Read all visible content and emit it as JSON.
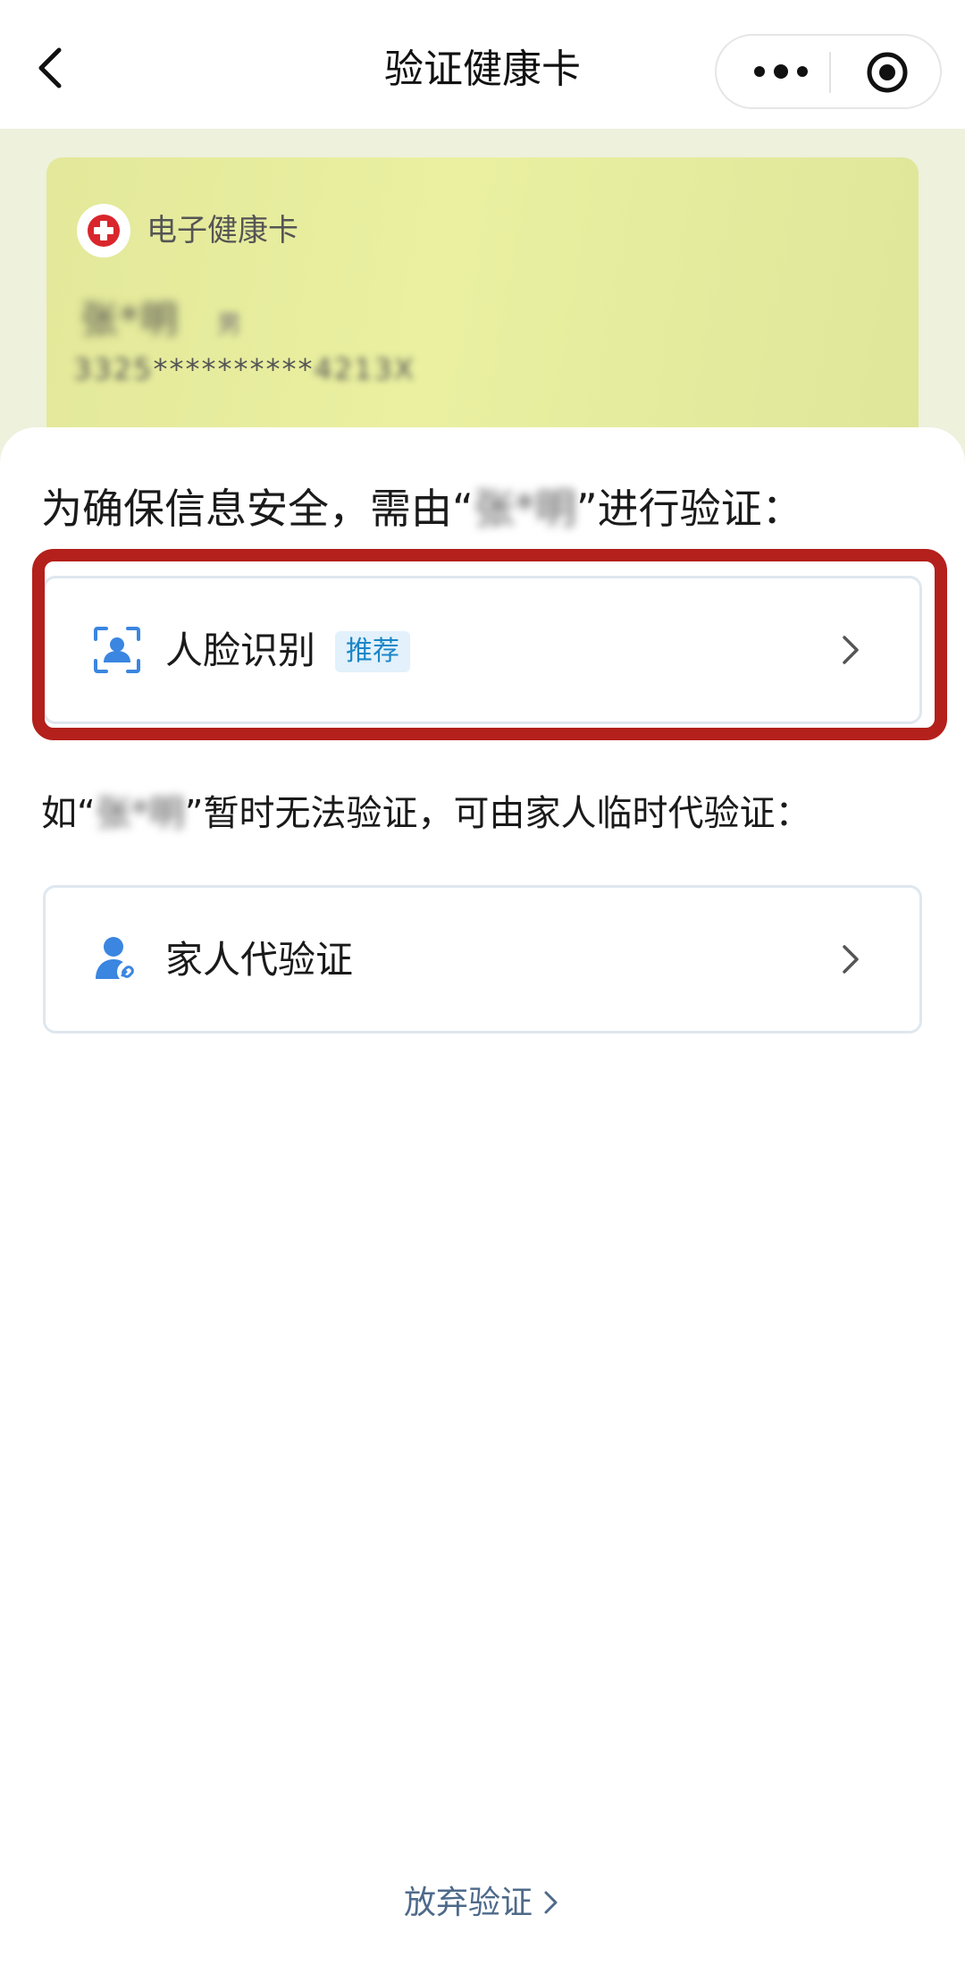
{
  "navbar": {
    "title": "验证健康卡",
    "back_icon": "chevron-left-icon",
    "more_icon": "more-dots-icon",
    "close_icon": "target-circle-icon"
  },
  "health_card": {
    "label": "电子健康卡",
    "name_masked": "张*明",
    "gender_masked": "男",
    "id_prefix": "3325",
    "id_stars": "**********",
    "id_suffix": "4213X",
    "colors": {
      "card_bg": "#e6eb9c",
      "logo_cross": "#d9262c"
    }
  },
  "sheet": {
    "prompt1_pre": "为确保信息安全，需由“",
    "prompt1_name": "张*明",
    "prompt1_post": "”进行验证：",
    "face_option": {
      "label": "人脸识别",
      "badge": "推荐",
      "icon": "face-scan-icon"
    },
    "prompt2_pre": "如“",
    "prompt2_name": "张*明",
    "prompt2_post": "”暂时无法验证，可由家人临时代验证：",
    "family_option": {
      "label": "家人代验证",
      "icon": "family-link-icon"
    },
    "abandon_label": "放弃验证",
    "highlight_color": "#b4201b",
    "accent_color": "#3a86e0"
  }
}
